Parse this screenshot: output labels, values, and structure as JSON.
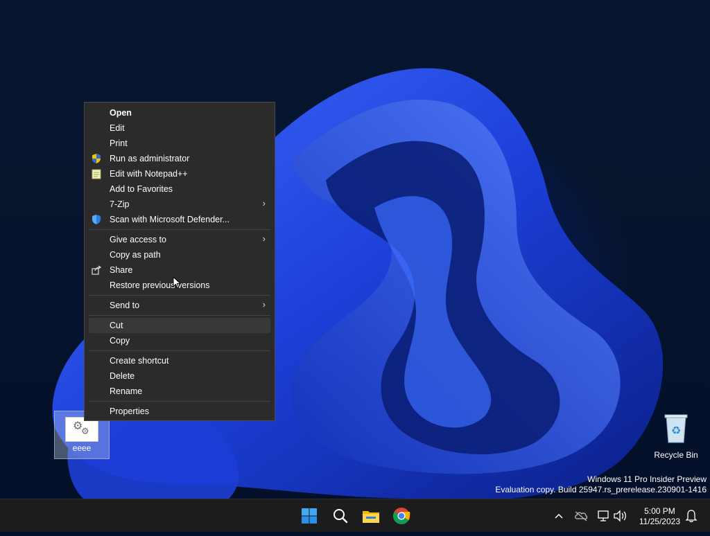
{
  "watermark": {
    "line1": "Windows 11 Pro Insider Preview",
    "line2": "Evaluation copy. Build 25947.rs_prerelease.230901-1416"
  },
  "desktop_icons": {
    "file": {
      "label": "eeee",
      "icon": "gears-file-icon"
    },
    "recycle_bin": {
      "label": "Recycle Bin",
      "icon": "recycle-bin-icon"
    }
  },
  "context_menu": {
    "open": "Open",
    "edit": "Edit",
    "print": "Print",
    "run_as_admin": "Run as administrator",
    "edit_notepadpp": "Edit with Notepad++",
    "add_favorites": "Add to Favorites",
    "seven_zip": "7-Zip",
    "scan_defender": "Scan with Microsoft Defender...",
    "give_access": "Give access to",
    "copy_as_path": "Copy as path",
    "share": "Share",
    "restore_previous": "Restore previous versions",
    "send_to": "Send to",
    "cut": "Cut",
    "copy": "Copy",
    "create_shortcut": "Create shortcut",
    "delete": "Delete",
    "rename": "Rename",
    "properties": "Properties",
    "submenu_arrow": "›"
  },
  "taskbar": {
    "apps": [
      "start-icon",
      "search-icon",
      "file-explorer-icon",
      "chrome-icon"
    ],
    "tray_icons": [
      "chevron-up-icon",
      "cloud-off-icon",
      "network-icon",
      "volume-icon",
      "notification-bell-icon"
    ],
    "time": "5:00 PM",
    "date": "11/25/2023"
  },
  "colors": {
    "menu_bg": "#2b2b2b",
    "menu_highlight": "#383838",
    "taskbar_bg": "#1c1c1c",
    "wallpaper_blue": "#1a3fe0"
  }
}
